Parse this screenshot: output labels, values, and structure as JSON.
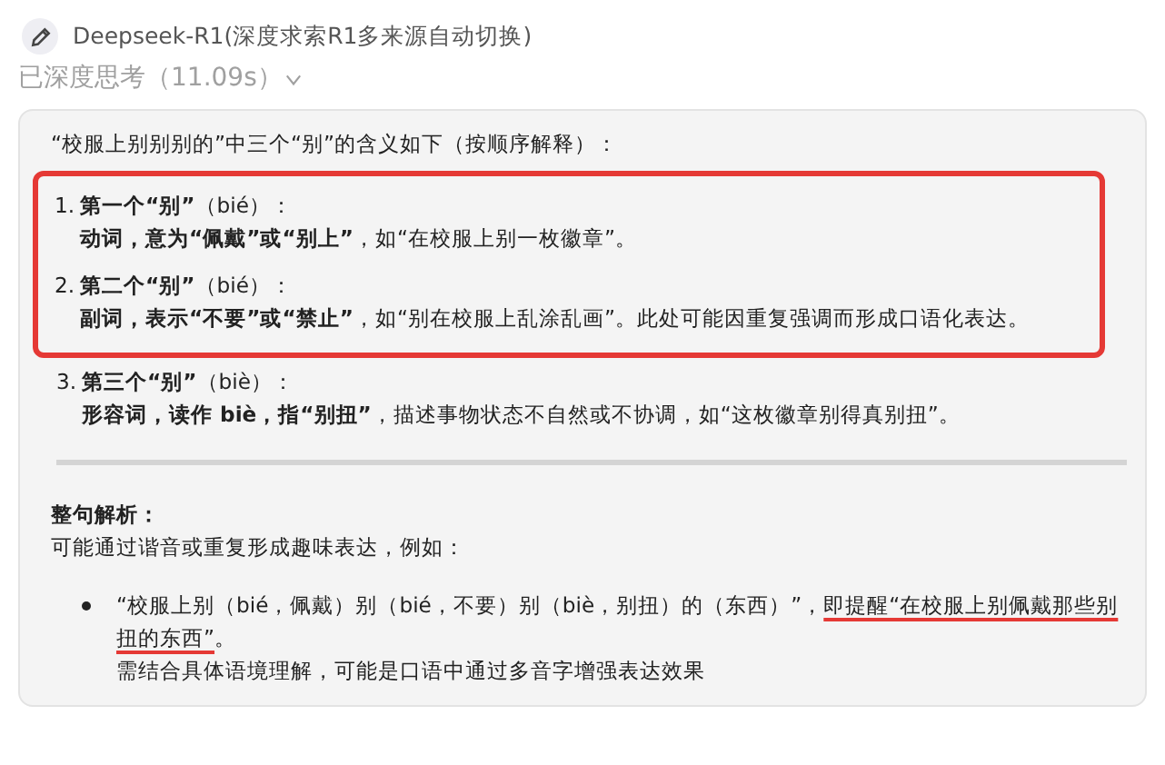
{
  "header": {
    "model": "Deepseek-R1(深度求索R1多来源自动切换)",
    "thinking": "已深度思考（11.09s）",
    "thinking_expanded": false
  },
  "answer": {
    "intro": "“校服上别别别的”中三个“别”的含义如下（按顺序解释）：",
    "items": [
      {
        "number": "1.",
        "title": "第一个“别”",
        "pinyin": "（bié）：",
        "desc": "**动词，意为“佩戴”或“别上”**，如“在校服上别一枚徽章”。",
        "highlighted": true
      },
      {
        "number": "2.",
        "title": "第二个“别”",
        "pinyin": "（bié）：",
        "desc": "**副词，表示“不要”或“禁止”**，如“别在校服上乱涂乱画”。此处可能因重复强调而形成口语化表达。",
        "highlighted": true
      },
      {
        "number": "3.",
        "title": "第三个“别”",
        "pinyin": "（biè）：",
        "desc": "**形容词，读作 biè，指“别扭”**，描述事物状态不自然或不协调，如“这枚徽章别得真别扭”。",
        "highlighted": false
      }
    ],
    "summary_heading": "整句解析：",
    "summary": "可能通过谐音或重复形成趣味表达，例如：",
    "bullets": [
      {
        "parts": [
          {
            "text": "“校服上别（bié，佩戴）别（bié，不要）别（biè，别扭）的（东西）”，",
            "marked": false
          },
          {
            "text": "即提醒“在校服上别佩戴那些别扭的东西”",
            "marked": true
          },
          {
            "text": "。",
            "marked": false
          }
        ],
        "note": "需结合具体语境理解，可能是口语中通过多音字增强表达效果"
      }
    ]
  }
}
